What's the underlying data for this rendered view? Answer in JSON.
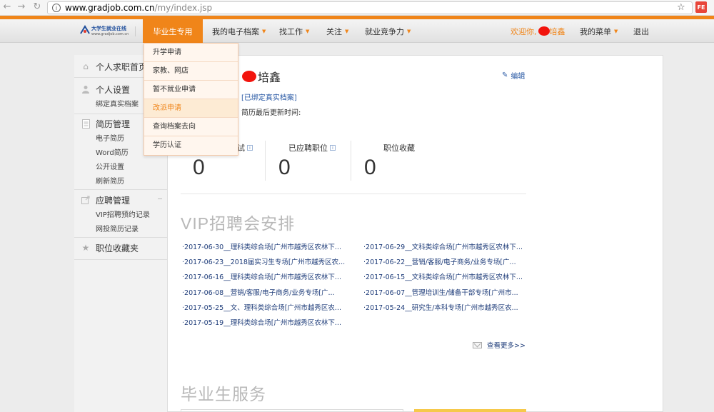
{
  "browser": {
    "url_host": "www.gradjob.com.cn",
    "url_path": "/my/index.jsp",
    "ext_badge": "FE"
  },
  "logo": {
    "title": "大学生就业在线",
    "subtitle": "www.gradjob.com.cn"
  },
  "nav": {
    "items": [
      {
        "label": "毕业生专用",
        "has_caret": false
      },
      {
        "label": "我的电子档案",
        "has_caret": true
      },
      {
        "label": "找工作",
        "has_caret": true
      },
      {
        "label": "关注",
        "has_caret": true
      },
      {
        "label": "就业竞争力",
        "has_caret": true
      }
    ],
    "welcome": "欢迎你,",
    "welcome_name_tail": "培鑫",
    "my_menu": "我的菜单",
    "logout": "退出"
  },
  "dropdown": {
    "items": [
      "升学申请",
      "家教、网店",
      "暂不就业申请",
      "改派申请",
      "查询档案去向",
      "学历认证"
    ],
    "hover_index": 3
  },
  "sidebar": {
    "sections": [
      {
        "title": "个人求职首页",
        "icon": "home-icon",
        "items": []
      },
      {
        "title": "个人设置",
        "icon": "user-icon",
        "items": [
          "绑定真实档案"
        ]
      },
      {
        "title": "简历管理",
        "icon": "document-icon",
        "items": [
          "电子简历",
          "Word简历",
          "公开设置",
          "刷新简历"
        ]
      },
      {
        "title": "应聘管理",
        "icon": "export-icon",
        "items": [
          "VIP招聘预约记录",
          "网投简历记录"
        ]
      },
      {
        "title": "职位收藏夹",
        "icon": "star-icon",
        "items": []
      }
    ]
  },
  "profile": {
    "name_tail": "培鑫",
    "edit": "编辑",
    "bound_link": "[已绑定真实档案]",
    "update_label": "简历最后更新时间:"
  },
  "stats": [
    {
      "label": "试",
      "value": "0"
    },
    {
      "label": "已应聘职位",
      "value": "0"
    },
    {
      "label": "职位收藏",
      "value": "0"
    }
  ],
  "vip_section": {
    "title": "VIP招聘会安排",
    "left": [
      "·2017-06-30__理科类综合场[广州市越秀区农林下...",
      "·2017-06-23__2018届实习生专场[广州市越秀区农...",
      "·2017-06-16__理科类综合场[广州市越秀区农林下...",
      "·2017-06-08__营销/客服/电子商务/业务专场[广...",
      "·2017-05-25__文、理科类综合场[广州市越秀区农...",
      "·2017-05-19__理科类综合场[广州市越秀区农林下..."
    ],
    "right": [
      "·2017-06-29__文科类综合场[广州市越秀区农林下...",
      "·2017-06-22__营销/客服/电子商务/业务专场[广...",
      "·2017-06-15__文科类综合场[广州市越秀区农林下...",
      "·2017-06-07__管理培训生/储备干部专场[广州市...",
      "·2017-05-24__研究生/本科专场[广州市越秀区农..."
    ],
    "more": "查看更多>>"
  },
  "service_section": {
    "title": "毕业生服务"
  },
  "colors": {
    "accent": "#f08519",
    "link": "#1f3d7a",
    "redact": "#f2140d"
  }
}
